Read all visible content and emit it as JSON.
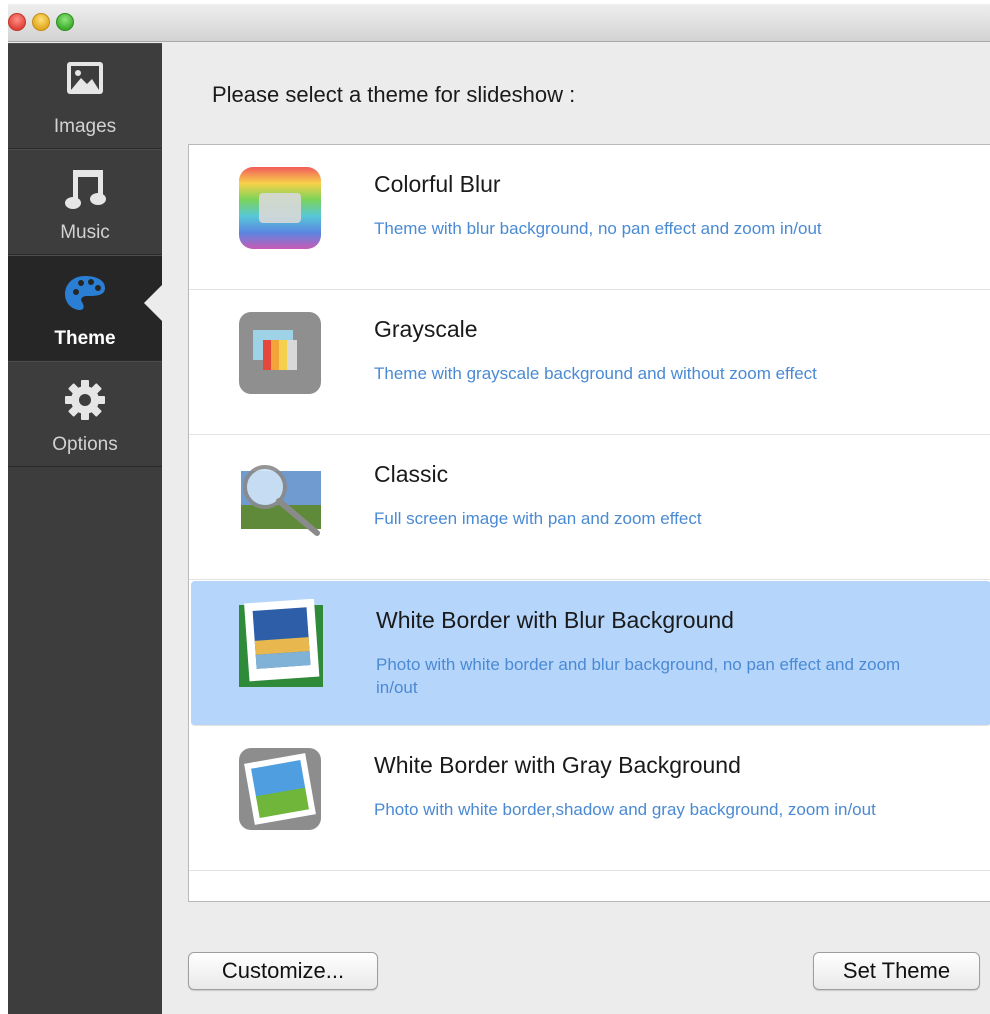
{
  "window": {
    "traffic_lights": [
      "close",
      "minimize",
      "maximize"
    ]
  },
  "sidebar": {
    "items": [
      {
        "id": "images",
        "label": "Images",
        "icon": "image-icon",
        "active": false
      },
      {
        "id": "music",
        "label": "Music",
        "icon": "music-note-icon",
        "active": false
      },
      {
        "id": "theme",
        "label": "Theme",
        "icon": "palette-icon",
        "active": true
      },
      {
        "id": "options",
        "label": "Options",
        "icon": "gear-icon",
        "active": false
      }
    ]
  },
  "main": {
    "prompt": "Please select a theme for slideshow :",
    "themes": [
      {
        "name": "Colorful Blur",
        "description": "Theme with blur background, no pan effect and zoom in/out",
        "icon": "colorful-blur-thumbnail-icon",
        "selected": false
      },
      {
        "name": "Grayscale",
        "description": "Theme with grayscale background and without zoom effect",
        "icon": "grayscale-thumbnail-icon",
        "selected": false
      },
      {
        "name": "Classic",
        "description": "Full screen image with pan and zoom effect",
        "icon": "classic-magnifier-thumbnail-icon",
        "selected": false
      },
      {
        "name": "White Border with Blur Background",
        "description": "Photo with white border and blur background, no pan effect and zoom in/out",
        "icon": "white-border-blur-thumbnail-icon",
        "selected": true
      },
      {
        "name": "White Border with Gray Background",
        "description": "Photo with white border,shadow and gray background, zoom in/out",
        "icon": "white-border-gray-thumbnail-icon",
        "selected": false
      },
      {
        "name": "",
        "description": "",
        "icon": "partially-visible-thumbnail-icon",
        "selected": false
      }
    ]
  },
  "footer": {
    "customize_label": "Customize...",
    "set_theme_label": "Set Theme"
  },
  "colors": {
    "sidebar_bg": "#3d3d3d",
    "sidebar_active_bg": "#262626",
    "selection": "#b6d5fb",
    "description_text": "#4a8ad4",
    "theme_icon_accent": "#2a7fd4"
  }
}
